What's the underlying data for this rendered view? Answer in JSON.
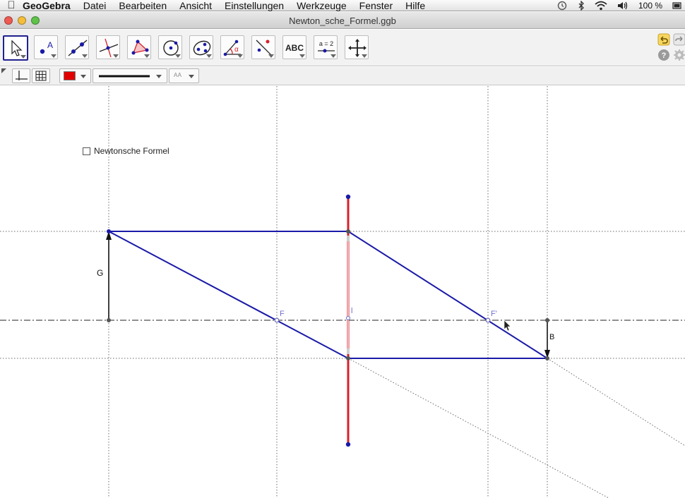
{
  "menubar": {
    "app_name": "GeoGebra",
    "items": [
      "Datei",
      "Bearbeiten",
      "Ansicht",
      "Einstellungen",
      "Werkzeuge",
      "Fenster",
      "Hilfe"
    ],
    "battery": "100 %"
  },
  "window": {
    "title": "Newton_sche_Formel.ggb"
  },
  "toolbar": {
    "selected_tool": "move-tool",
    "text_tool_label": "ABC",
    "slider_tool_label": "a = 2"
  },
  "stylebar": {
    "color": "#e00000",
    "text_size_label": "A A"
  },
  "graphics": {
    "checkbox_label": "Newtonsche Formel",
    "checkbox_checked": false,
    "labels": {
      "object": "G",
      "image": "B",
      "focus_left": "F",
      "focus_right": "F'",
      "lens_center": "l"
    }
  },
  "colors": {
    "ray": "#1a1aa8",
    "lens": "#d9202a",
    "point": "#1a1aa8",
    "focus_label": "#7070d0"
  }
}
